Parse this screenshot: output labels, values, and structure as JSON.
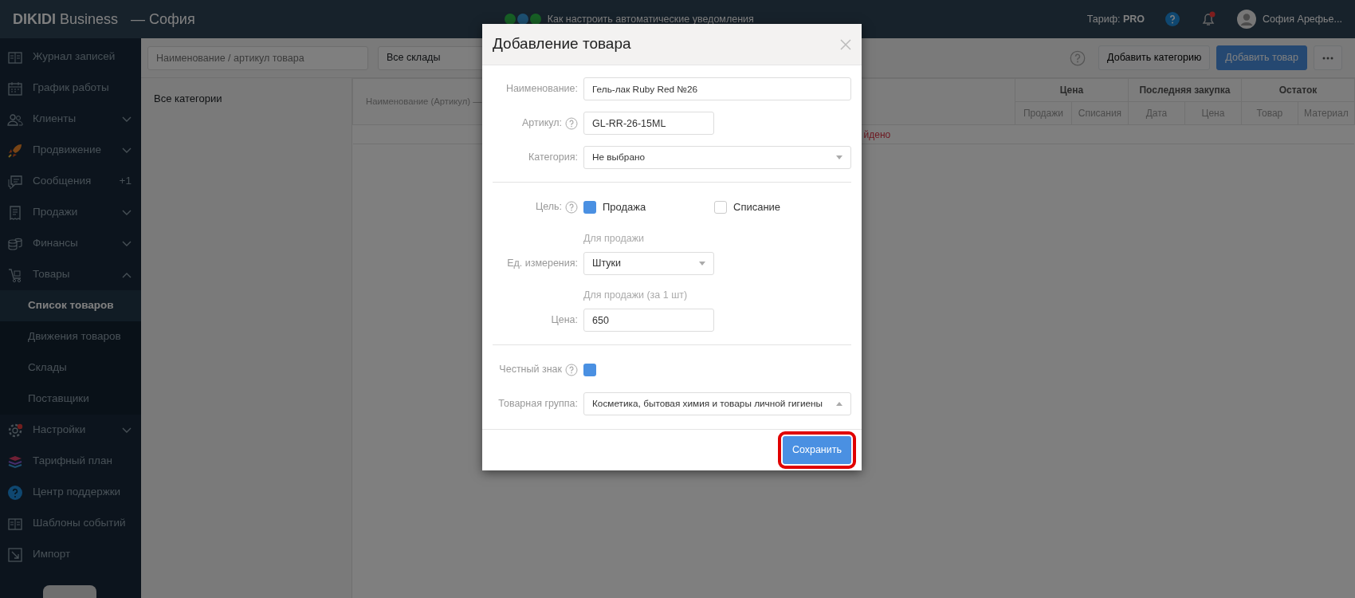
{
  "topbar": {
    "brand": "**DIKIDI** Business",
    "brand_suffix": "— София",
    "promo": "Как настроить автоматические уведомления",
    "tariff": "Тариф: **PRO**",
    "notifications_unread": true,
    "user_name": "София Арефье..."
  },
  "sidebar": {
    "items": [
      {
        "kind": "link",
        "label": "Журнал записей",
        "selected": false
      },
      {
        "kind": "link",
        "label": "График работы",
        "selected": false
      },
      {
        "kind": "group",
        "label": "Клиенты",
        "selected": false,
        "expanded": false
      },
      {
        "kind": "group",
        "label": "Продвижение",
        "selected": false,
        "expanded": false
      },
      {
        "kind": "link",
        "label": "Сообщения",
        "selected": false,
        "badge": "+1"
      },
      {
        "kind": "group",
        "label": "Продажи",
        "selected": false,
        "expanded": false
      },
      {
        "kind": "group",
        "label": "Финансы",
        "selected": false,
        "expanded": false
      },
      {
        "kind": "group",
        "label": "Товары",
        "selected": false,
        "expanded": true,
        "children": [
          {
            "label": "Список товаров",
            "selected": true
          },
          {
            "label": "Движения товаров",
            "selected": false
          },
          {
            "label": "Склады",
            "selected": false
          },
          {
            "label": "Поставщики",
            "selected": false
          }
        ]
      },
      {
        "kind": "group",
        "label": "Настройки",
        "selected": false,
        "expanded": false,
        "alert": true
      },
      {
        "kind": "link",
        "label": "Тарифный план",
        "selected": false
      },
      {
        "kind": "link",
        "label": "Центр поддержки",
        "selected": false
      },
      {
        "kind": "link",
        "label": "Шаблоны событий",
        "selected": false
      },
      {
        "kind": "link",
        "label": "Импорт",
        "selected": false
      }
    ]
  },
  "toolbar": {
    "search": {
      "placeholder": "Наименование / артикул товара"
    },
    "warehouse": "Все склады",
    "buttons": [
      {
        "label": "Добавить категорию",
        "primary": false
      },
      {
        "label": "Добавить товар",
        "primary": true
      }
    ]
  },
  "categories": [
    "Все категории"
  ],
  "table": {
    "first_column": "Наименование (Артикул) —",
    "column_groups": [
      {
        "label": "Цена",
        "columns": [
          "Продажи",
          "Списания"
        ]
      },
      {
        "label": "Последняя закупка",
        "columns": [
          "Дата",
          "Цена"
        ]
      },
      {
        "label": "Остаток",
        "columns": [
          "Товар",
          "Материал"
        ]
      }
    ],
    "empty_message": "йдено"
  },
  "modal": {
    "title": "Добавление товара",
    "rows": [
      {
        "kind": "input_wide",
        "label": "Наименование:",
        "help": false,
        "value": "Гель-лак Ruby Red №26"
      },
      {
        "kind": "input",
        "label": "Артикул:",
        "help": true,
        "value": "GL-RR-26-15ML"
      },
      {
        "kind": "select_wide",
        "label": "Категория:",
        "help": false,
        "value": "Не выбрано",
        "open": false
      },
      {
        "kind": "divider"
      },
      {
        "kind": "options",
        "label": "Цель:",
        "help": true,
        "options": [
          {
            "label": "Продажа",
            "checked": true
          },
          {
            "label": "Списание",
            "checked": false
          }
        ]
      },
      {
        "kind": "note",
        "text": "Для продажи"
      },
      {
        "kind": "select",
        "label": "Ед. измерения:",
        "help": false,
        "value": "Штуки",
        "open": false
      },
      {
        "kind": "note",
        "text": "Для продажи (за 1 шт)"
      },
      {
        "kind": "input",
        "label": "Цена:",
        "help": false,
        "value": "650"
      },
      {
        "kind": "divider"
      },
      {
        "kind": "checkbox",
        "label": "Честный знак",
        "help": true,
        "checked": true
      },
      {
        "kind": "select_wide",
        "label": "Товарная группа:",
        "help": false,
        "value": "Косметика, бытовая химия и товары личной гигиены",
        "open": true
      }
    ],
    "save_button": {
      "label": "Сохранить",
      "highlighted": true
    }
  }
}
